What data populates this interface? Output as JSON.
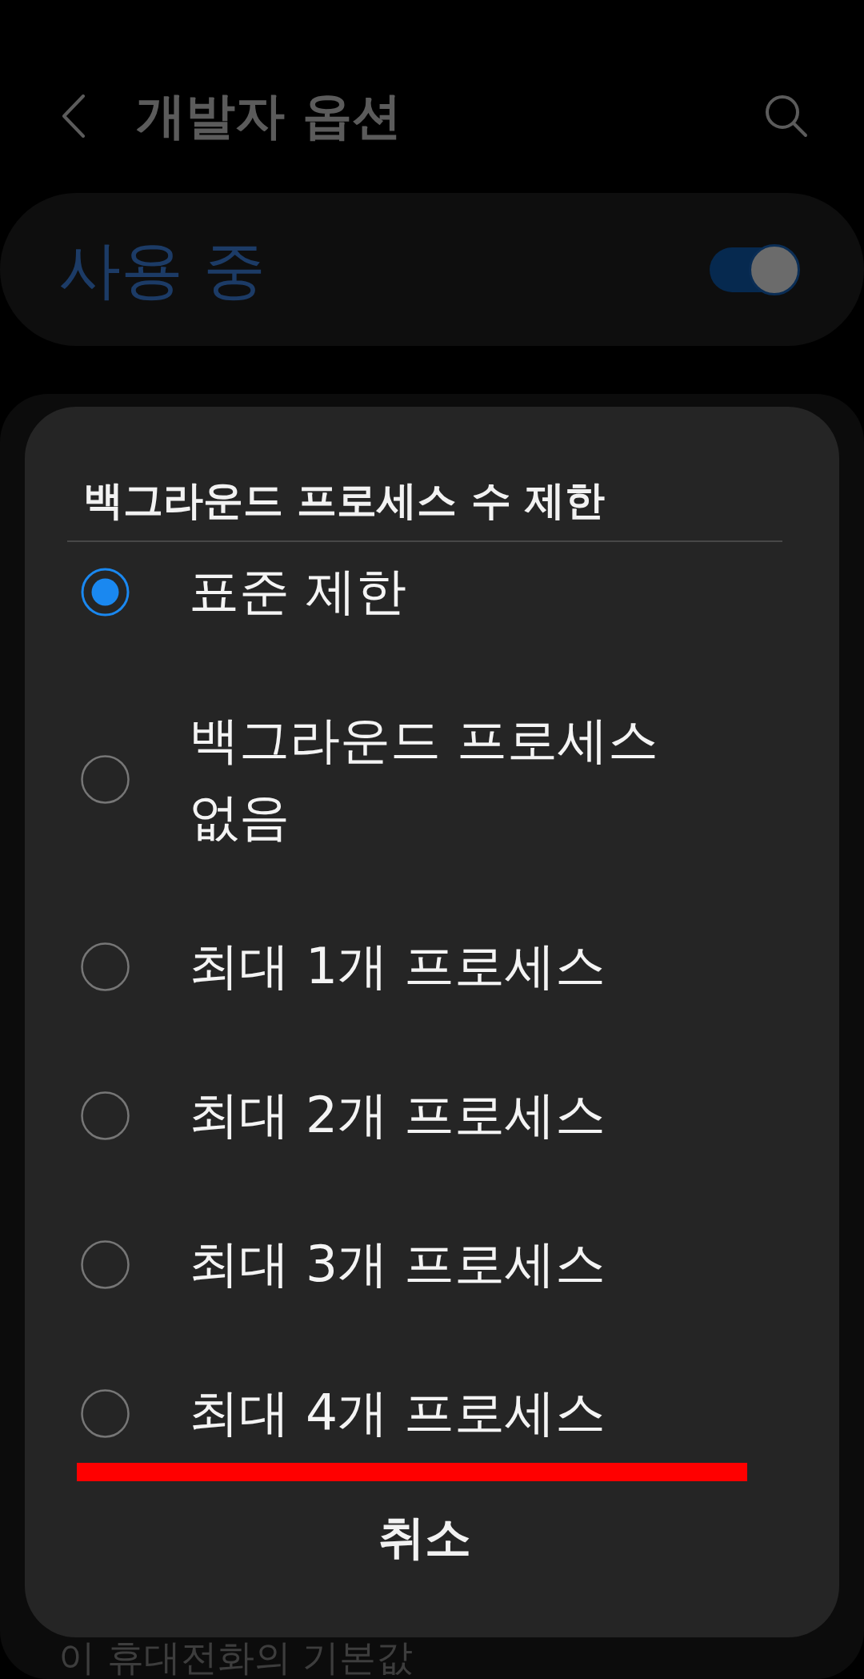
{
  "header": {
    "title": "개발자 옵션"
  },
  "master_switch": {
    "label": "사용 중",
    "on": true
  },
  "background_list": {
    "summary": "이 휴대전화의 기본값"
  },
  "dialog": {
    "title": "백그라운드 프로세스 수 제한",
    "options": [
      {
        "label": "표준 제한",
        "selected": true,
        "marked": false
      },
      {
        "label": "백그라운드 프로세스 없음",
        "selected": false,
        "marked": false
      },
      {
        "label": "최대 1개 프로세스",
        "selected": false,
        "marked": false
      },
      {
        "label": "최대 2개 프로세스",
        "selected": false,
        "marked": false
      },
      {
        "label": "최대 3개 프로세스",
        "selected": false,
        "marked": false
      },
      {
        "label": "최대 4개 프로세스",
        "selected": false,
        "marked": true
      }
    ],
    "cancel_button": "취소"
  }
}
